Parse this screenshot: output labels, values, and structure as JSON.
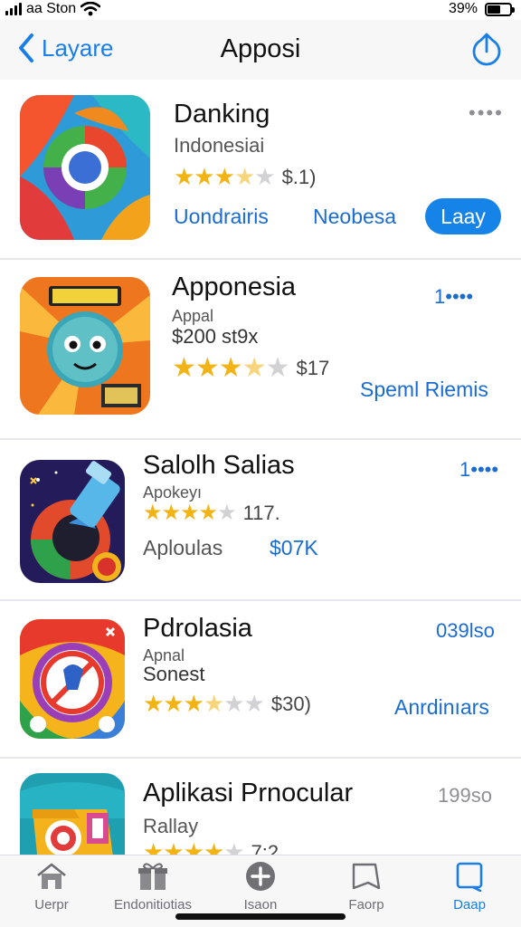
{
  "status_bar": {
    "carrier": "aa Ston",
    "battery": "39%",
    "icons": [
      "signal-icon",
      "wifi-icon",
      "battery-icon"
    ]
  },
  "nav": {
    "back_label": "Layare",
    "title": "Apposi",
    "icons": [
      "chevron-left-icon",
      "share-icon"
    ]
  },
  "apps": [
    {
      "name": "Danking",
      "subtitle": "Indonesiai",
      "rating_stars": 3.5,
      "rating_text": "$.1)",
      "link_1": "Uondrairis",
      "link_2": "Neobesa",
      "button": "Laay",
      "more": "••••",
      "icon": "ring-logo-icon"
    },
    {
      "name": "Apponesia",
      "subtitle": "Appal",
      "price": "$200 st9x",
      "rating_stars": 3.5,
      "rating_text": "$17",
      "link_1": "Speml Riemis",
      "more": "1••••",
      "icon": "cartoon-robot-icon"
    },
    {
      "name": "Salolh Salias",
      "subtitle": "Apokeyı",
      "rating_stars": 4,
      "rating_text": "117.",
      "link_1": "Aploulas",
      "link_2": "$07K",
      "more": "1••••",
      "icon": "paint-tube-icon"
    },
    {
      "name": "Pdrolasia",
      "subtitle": "Apnal",
      "price": "Sonest",
      "rating_stars": 3.5,
      "rating_text": "$30)",
      "link_1": "Anrdinıars",
      "more": "039lso",
      "icon": "stop-sign-icon"
    },
    {
      "name": "Aplikasi Prnocular",
      "subtitle": "Rallay",
      "rating_stars": 4,
      "rating_text": "7:2",
      "more": "199so",
      "icon": "folder-target-icon"
    }
  ],
  "tabs": [
    {
      "label": "Uerpr",
      "icon": "home-icon"
    },
    {
      "label": "Endonitiotias",
      "icon": "gift-box-icon"
    },
    {
      "label": "Isaon",
      "icon": "plus-circle-icon"
    },
    {
      "label": "Faorp",
      "icon": "book-icon"
    },
    {
      "label": "Daap",
      "icon": "tablet-icon",
      "active": true
    }
  ],
  "colors": {
    "accent": "#1a7ee8",
    "link": "#1a6cd0",
    "star": "#f2b414",
    "nav_bg": "#f7f7f8",
    "divider": "#e6e7ea"
  }
}
